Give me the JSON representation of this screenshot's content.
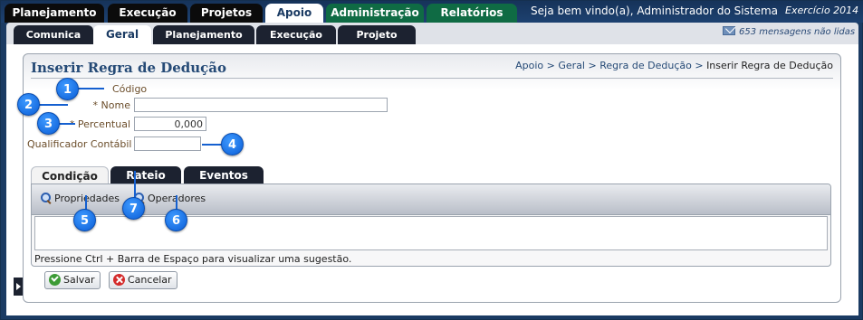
{
  "top_nav": {
    "tabs": [
      "Planejamento",
      "Execução",
      "Projetos",
      "Apoio",
      "Administração",
      "Relatórios"
    ],
    "welcome": "Seja bem vindo(a), Administrador do Sistema",
    "exercicio": "Exercício 2014"
  },
  "sub_nav": {
    "tabs": [
      "Comunica",
      "Geral",
      "Planejamento",
      "Execução",
      "Projeto"
    ],
    "messages": "653 mensagens não lidas"
  },
  "page": {
    "title": "Inserir Regra de Dedução",
    "breadcrumb": {
      "apoio": "Apoio",
      "geral": "Geral",
      "regra": "Regra de Dedução",
      "current": "Inserir Regra de Dedução",
      "sep": ">"
    }
  },
  "form": {
    "codigo_label": "Código",
    "nome_label": "* Nome",
    "nome_value": "",
    "percentual_label": "* Percentual",
    "percentual_value": "0,000",
    "qualificador_label": "Qualificador Contábil",
    "qualificador_value": ""
  },
  "inner_tabs": [
    "Condição",
    "Rateio",
    "Eventos"
  ],
  "condicao": {
    "propriedades": "Propriedades",
    "operadores": "Operadores",
    "expression_value": "",
    "hint": "Pressione Ctrl + Barra de Espaço para visualizar uma sugestão."
  },
  "buttons": {
    "save": "Salvar",
    "cancel": "Cancelar"
  },
  "callouts": [
    "1",
    "2",
    "3",
    "4",
    "5",
    "6",
    "7"
  ],
  "colors": {
    "header_bg": "#1b3b63",
    "active_tab_green": "#0f6b44",
    "callout_blue": "#0a5dd6",
    "label_brown": "#6b4d2a"
  }
}
